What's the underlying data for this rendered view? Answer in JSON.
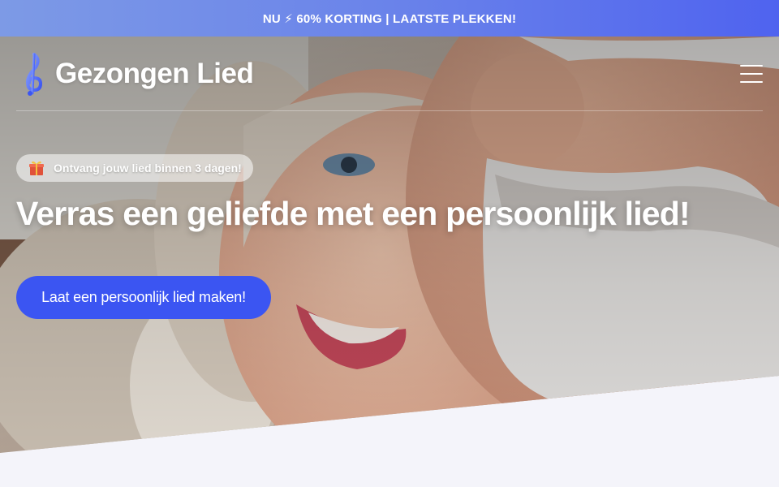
{
  "promo": {
    "text": "NU ⚡ 60% KORTING | LAATSTE PLEKKEN!"
  },
  "header": {
    "brand_first": "Gezongen",
    "brand_second": "Lied",
    "menu_icon": "hamburger-menu-icon"
  },
  "hero": {
    "badge_icon": "gift-icon",
    "badge_text": "Ontvang jouw lied binnen 3 dagen!",
    "headline": "Verras een geliefde met een persoonlijk lied!",
    "cta_label": "Laat een persoonlijk lied maken!"
  },
  "colors": {
    "accent": "#3b55f2",
    "promo_gradient_start": "#7d9ae6",
    "promo_gradient_end": "#4f63ef",
    "page_background": "#f4f4fa"
  }
}
